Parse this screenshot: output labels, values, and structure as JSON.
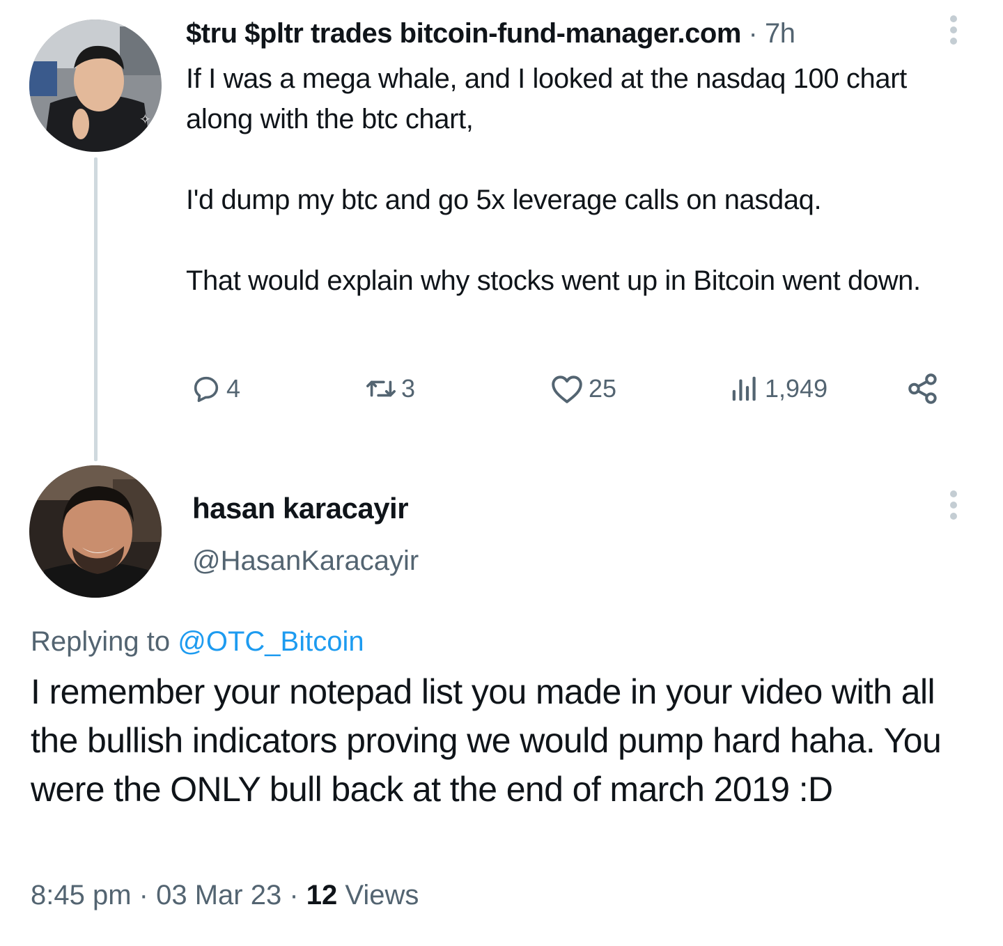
{
  "original_tweet": {
    "display_name": "$tru $pltr trades bitcoin-fund-manager.com",
    "separator": "·",
    "time_ago": "7h",
    "paragraphs": [
      "If I was a mega whale, and I looked at the nasdaq 100 chart along with the btc chart,",
      "I'd dump my btc and go 5x leverage calls on nasdaq.",
      "That would explain why stocks went up in Bitcoin went down."
    ],
    "actions": {
      "replies": "4",
      "retweets": "3",
      "likes": "25",
      "views": "1,949"
    },
    "icons": [
      "reply-icon",
      "retweet-icon",
      "like-icon",
      "views-icon",
      "share-icon",
      "more-icon"
    ]
  },
  "reply_tweet": {
    "display_name": "hasan karacayir",
    "handle": "@HasanKaracayir",
    "replying_to_label": "Replying to",
    "replying_to_handle": "@OTC_Bitcoin",
    "body": "I remember your notepad list you made in your video with all the bullish indicators proving we would pump hard haha. You were the ONLY bull back at the end of march 2019 :D",
    "time": "8:45 pm",
    "separator": "·",
    "date": "03 Mar 23",
    "views_count": "12",
    "views_label": "Views"
  },
  "colors": {
    "text_primary": "#0f1419",
    "text_secondary": "#536471",
    "link": "#1d9bf0",
    "thread_line": "#cfd9de"
  }
}
